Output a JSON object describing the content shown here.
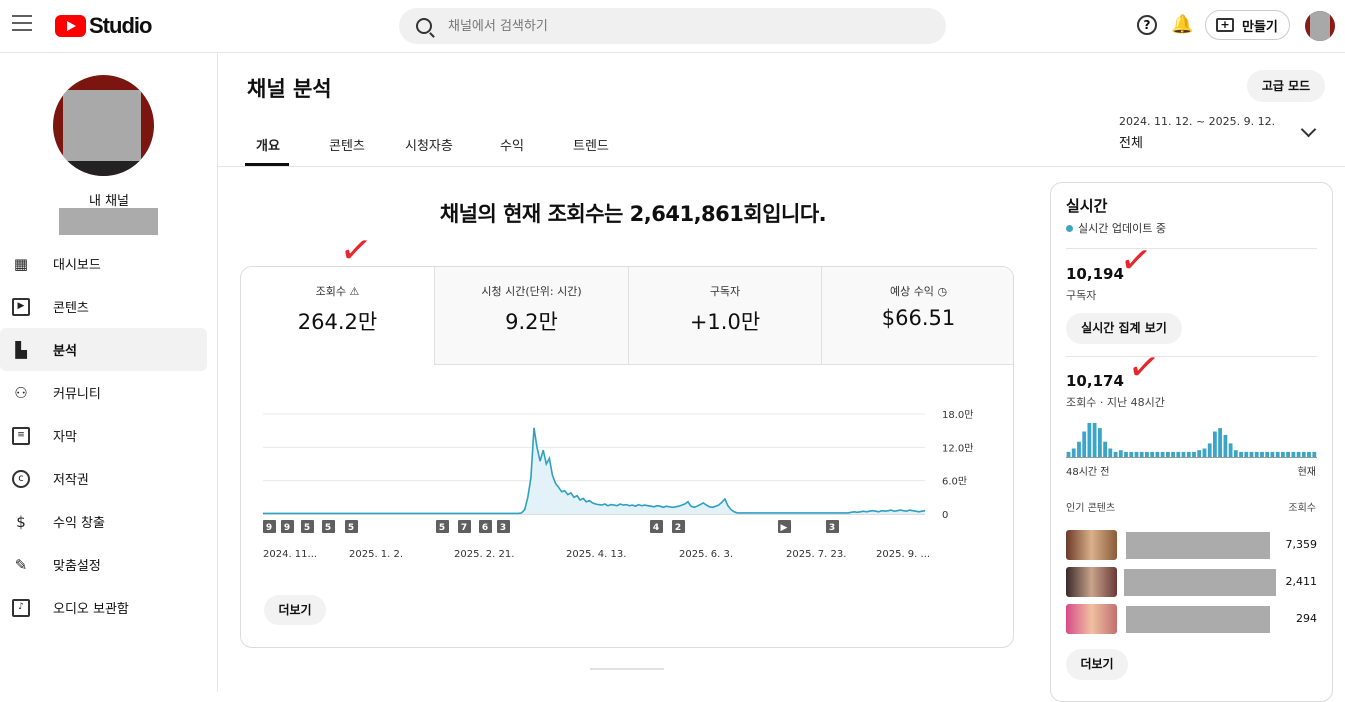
{
  "topbar": {
    "logo_text": "Studio",
    "search_placeholder": "채널에서 검색하기",
    "create_label": "만들기"
  },
  "sidebar": {
    "channel_name": "내 채널",
    "items": [
      {
        "label": "대시보드",
        "icon": "dashboard-icon"
      },
      {
        "label": "콘텐츠",
        "icon": "content-icon"
      },
      {
        "label": "분석",
        "icon": "analytics-icon",
        "active": true
      },
      {
        "label": "커뮤니티",
        "icon": "community-icon"
      },
      {
        "label": "자막",
        "icon": "subtitles-icon"
      },
      {
        "label": "저작권",
        "icon": "copyright-icon"
      },
      {
        "label": "수익 창출",
        "icon": "dollar-icon"
      },
      {
        "label": "맞춤설정",
        "icon": "customization-icon"
      },
      {
        "label": "오디오 보관함",
        "icon": "audio-library-icon"
      }
    ]
  },
  "page": {
    "title": "채널 분석",
    "advanced_mode": "고급 모드",
    "tabs": [
      "개요",
      "콘텐츠",
      "시청자층",
      "수익",
      "트렌드"
    ],
    "date_range": "2024. 11. 12. ~ 2025. 9. 12.",
    "date_value": "전체"
  },
  "overview": {
    "headline": "채널의 현재 조회수는 2,641,861회입니다.",
    "metrics": [
      {
        "label": "조회수",
        "value": "264.2만",
        "icon": "warning-icon"
      },
      {
        "label": "시청 시간(단위: 시간)",
        "value": "9.2만"
      },
      {
        "label": "구독자",
        "value": "+1.0만"
      },
      {
        "label": "예상 수익",
        "value": "$66.51",
        "icon": "clock-icon"
      }
    ],
    "more_label": "더보기"
  },
  "chart_data": {
    "type": "area",
    "y_ticks": [
      "18.0만",
      "12.0만",
      "6.0만",
      "0"
    ],
    "ylim": [
      0,
      180000
    ],
    "x_ticks": [
      "2024. 11...",
      "2025. 1. 2.",
      "2025. 2. 21.",
      "2025. 4. 13.",
      "2025. 6. 3.",
      "2025. 7. 23.",
      "2025. 9. ..."
    ],
    "markers": [
      "9",
      "9",
      "5",
      "5",
      "5",
      "5",
      "7",
      "6",
      "3",
      "4",
      "2",
      "▶",
      "3"
    ],
    "color": "#2ea0c0",
    "series": [
      {
        "values": [
          1000,
          1000,
          1000,
          1000,
          1000,
          1000,
          1000,
          1000,
          1000,
          1000,
          1000,
          1000,
          1000,
          1000,
          1000,
          1000,
          1000,
          1000,
          1000,
          1000,
          1000,
          1000,
          1000,
          1000,
          1000,
          1000,
          1000,
          1000,
          1000,
          1000,
          1000,
          1000,
          1000,
          1000,
          1000,
          1000,
          1000,
          1000,
          1000,
          1000,
          1000,
          1000,
          1000,
          1000,
          1000,
          1000,
          1000,
          1000,
          1000,
          1000,
          1000,
          1000,
          1000,
          1000,
          1000,
          1000,
          1000,
          1000,
          1000,
          1000,
          1000,
          1000,
          1000,
          1000,
          1000,
          1000,
          1000,
          1000,
          1000,
          1000,
          1000,
          1000,
          1000,
          1000,
          1000,
          1000,
          1000,
          1000,
          1000,
          1000,
          1000,
          1000,
          1000,
          1000,
          2000,
          8000,
          30000,
          65000,
          155000,
          120000,
          95000,
          115000,
          90000,
          100000,
          70000,
          55000,
          48000,
          40000,
          42000,
          35000,
          38000,
          30000,
          33000,
          25000,
          28000,
          22000,
          24000,
          20000,
          18000,
          17000,
          16000,
          18000,
          15000,
          17000,
          16000,
          15000,
          18000,
          16000,
          17000,
          15000,
          16000,
          14000,
          17000,
          15000,
          16000,
          15000,
          14000,
          13000,
          15000,
          14000,
          12000,
          14000,
          13000,
          12000,
          13000,
          14000,
          16000,
          18000,
          22000,
          14000,
          12000,
          14000,
          17000,
          20000,
          16000,
          13000,
          12000,
          14000,
          16000,
          21000,
          27000,
          15000,
          8000,
          4000,
          2000,
          2000,
          2000,
          2000,
          2000,
          2000,
          2000,
          2000,
          2000,
          2000,
          2000,
          2000,
          2000,
          2000,
          2000,
          2000,
          2000,
          2000,
          2000,
          2000,
          2000,
          2000,
          2000,
          2000,
          2000,
          2000,
          2000,
          2000,
          2000,
          2000,
          2000,
          2000,
          2000,
          2000,
          2000,
          2000,
          2000,
          3000,
          4000,
          3000,
          4000,
          5000,
          4000,
          5000,
          6000,
          5000,
          4000,
          6000,
          5000,
          6000,
          7000,
          5000,
          6000,
          7000,
          6000,
          5000,
          7000,
          6000,
          5000,
          4000,
          5000,
          6000
        ]
      }
    ]
  },
  "realtime": {
    "title": "실시간",
    "live_label": "실시간 업데이트 중",
    "subscribers_value": "10,194",
    "subscribers_label": "구독자",
    "live_count_button": "실시간 집계 보기",
    "views_value": "10,174",
    "views_label": "조회수 · 지난 48시간",
    "axis_left": "48시간 전",
    "axis_right": "현재",
    "bars": [
      3,
      5,
      9,
      15,
      20,
      20,
      17,
      9,
      5,
      3,
      4,
      3,
      3,
      3,
      3,
      3,
      3,
      3,
      3,
      3,
      3,
      3,
      3,
      3,
      3,
      4,
      5,
      8,
      15,
      17,
      13,
      8,
      4,
      3,
      3,
      3,
      3,
      3,
      3,
      3,
      3,
      3,
      3,
      3,
      3,
      3,
      3,
      3
    ],
    "top_header_left": "인기 콘텐츠",
    "top_header_right": "조회수",
    "top_content": [
      {
        "count": "7,359"
      },
      {
        "count": "2,411"
      },
      {
        "count": "294"
      }
    ],
    "more_label": "더보기"
  }
}
